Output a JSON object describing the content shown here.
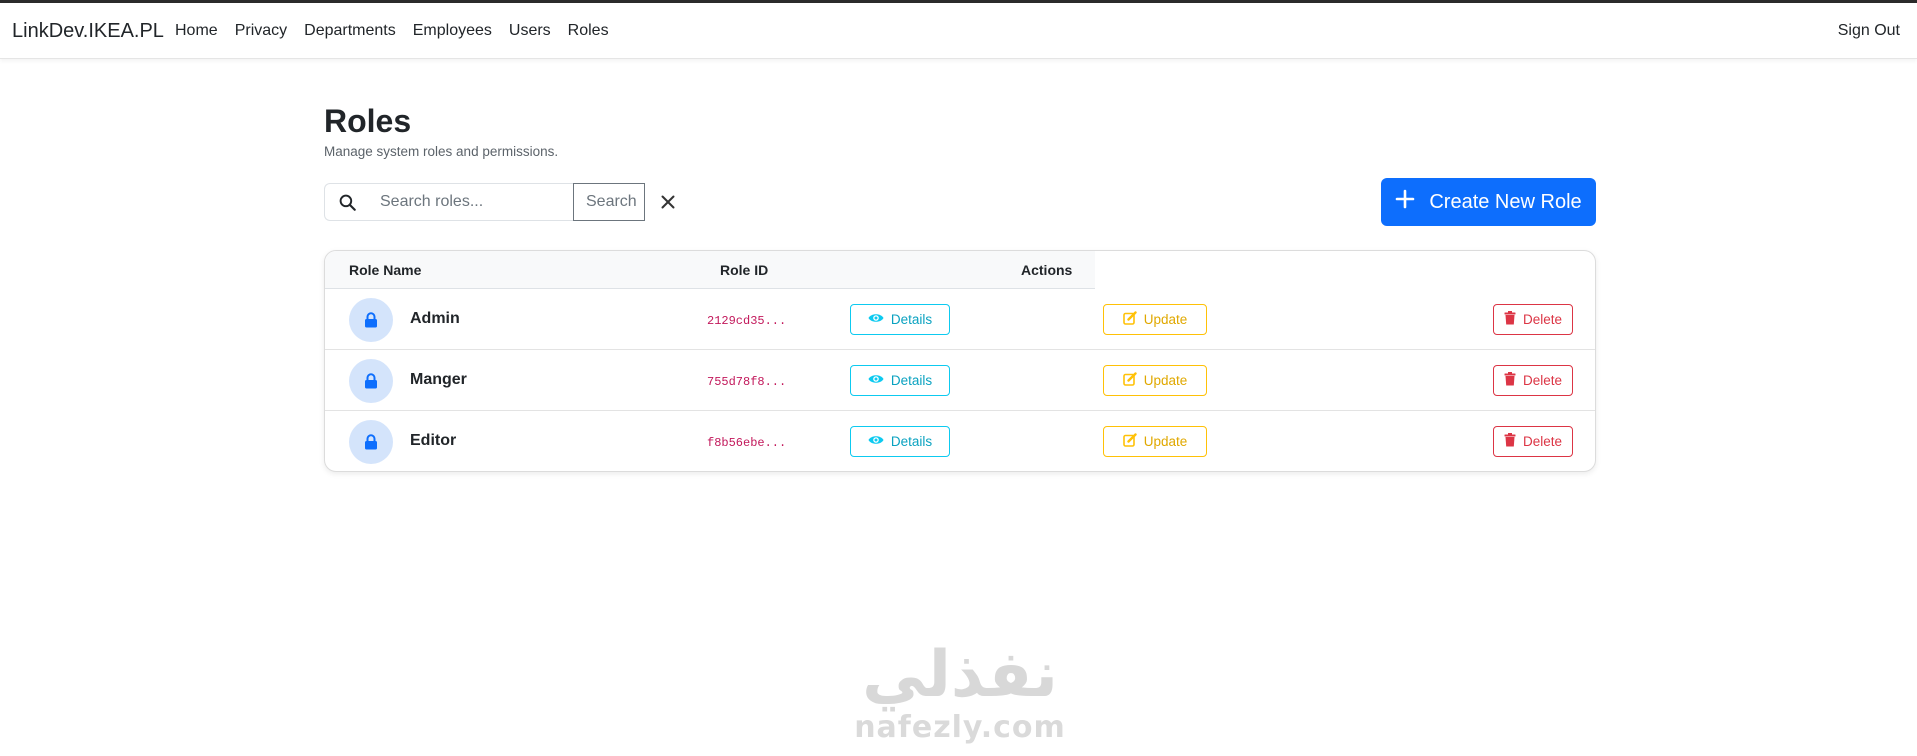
{
  "navbar": {
    "brand": "LinkDev.IKEA.PL",
    "links": [
      "Home",
      "Privacy",
      "Departments",
      "Employees",
      "Users",
      "Roles"
    ],
    "sign_out": "Sign Out"
  },
  "page": {
    "title": "Roles",
    "subtitle": "Manage system roles and permissions."
  },
  "search": {
    "placeholder": "Search roles...",
    "value": "",
    "button_label": "Search",
    "clear_icon": "close-icon"
  },
  "create_button": {
    "label": "Create New Role",
    "icon": "plus-icon"
  },
  "table": {
    "headers": [
      "Role Name",
      "Role ID",
      "Actions"
    ],
    "rows": [
      {
        "name": "Admin",
        "id": "2129cd35...",
        "details": "Details",
        "update": "Update",
        "delete": "Delete"
      },
      {
        "name": "Manger",
        "id": "755d78f8...",
        "details": "Details",
        "update": "Update",
        "delete": "Delete"
      },
      {
        "name": "Editor",
        "id": "f8b56ebe...",
        "details": "Details",
        "update": "Update",
        "delete": "Delete"
      }
    ]
  },
  "watermark": {
    "arabic": "نفذلي",
    "latin": "nafezly.com"
  },
  "colors": {
    "primary": "#0d6efd",
    "info": "#0dcaf0",
    "warning": "#ffc107",
    "danger": "#dc3545",
    "avatar_bg": "#d4e4fb"
  }
}
